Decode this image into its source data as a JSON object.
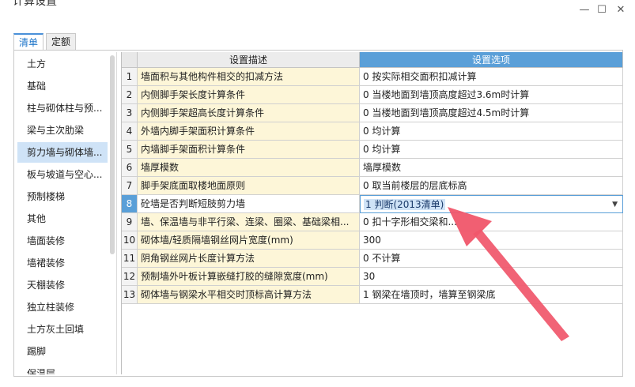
{
  "window": {
    "title": "计算设置"
  },
  "tabs": [
    {
      "label": "清单",
      "active": true
    },
    {
      "label": "定额",
      "active": false
    }
  ],
  "sidebar": {
    "items": [
      {
        "label": "土方"
      },
      {
        "label": "基础"
      },
      {
        "label": "柱与砌体柱与预..."
      },
      {
        "label": "梁与主次肋梁"
      },
      {
        "label": "剪力墙与砌体墙...",
        "selected": true
      },
      {
        "label": "板与坡道与空心..."
      },
      {
        "label": "预制楼梯"
      },
      {
        "label": "其他"
      },
      {
        "label": "墙面装修"
      },
      {
        "label": "墙裙装修"
      },
      {
        "label": "天棚装修"
      },
      {
        "label": "独立柱装修"
      },
      {
        "label": "土方灰土回填"
      },
      {
        "label": "踢脚"
      },
      {
        "label": "保温层"
      }
    ]
  },
  "grid": {
    "headers": {
      "description": "设置描述",
      "option": "设置选项"
    },
    "rows": [
      {
        "num": "1",
        "desc": "墙面积与其他构件相交的扣减方法",
        "opt": "0 按实际相交面积扣减计算"
      },
      {
        "num": "2",
        "desc": "内侧脚手架长度计算条件",
        "opt": "0 当楼地面到墙顶高度超过3.6m时计算"
      },
      {
        "num": "3",
        "desc": "内侧脚手架超高长度计算条件",
        "opt": "0 当楼地面到墙顶高度超过4.5m时计算"
      },
      {
        "num": "4",
        "desc": "外墙内脚手架面积计算条件",
        "opt": "0 均计算"
      },
      {
        "num": "5",
        "desc": "内墙脚手架面积计算条件",
        "opt": "0 均计算"
      },
      {
        "num": "6",
        "desc": "墙厚模数",
        "opt": "墙厚模数"
      },
      {
        "num": "7",
        "desc": "脚手架底面取楼地面原则",
        "opt": "0 取当前楼层的层底标高"
      },
      {
        "num": "8",
        "desc": "砼墙是否判断短肢剪力墙",
        "opt": "1 判断(2013清单)",
        "active": true
      },
      {
        "num": "9",
        "desc": "墙、保温墙与非平行梁、连梁、圈梁、基础梁相...",
        "opt": "0 扣十字形相交梁和..."
      },
      {
        "num": "10",
        "desc": "砌体墙/轻质隔墙钢丝网片宽度(mm)",
        "opt": "300"
      },
      {
        "num": "11",
        "desc": "阴角钢丝网片长度计算方法",
        "opt": "0 不计算"
      },
      {
        "num": "12",
        "desc": "预制墙外叶板计算嵌缝打胶的缝隙宽度(mm)",
        "opt": "30"
      },
      {
        "num": "13",
        "desc": "砌体墙与钢梁水平相交时顶标高计算方法",
        "opt": "1 钢梁在墙顶时，墙算至钢梁底"
      }
    ]
  },
  "colors": {
    "header_option_bg": "#5a9fd8",
    "description_cell_bg": "#fdf6d8",
    "sidebar_selected_bg": "#cfe3f7",
    "annotation_arrow": "#f0566a"
  },
  "icons": {
    "minimize": "minimize-icon",
    "maximize": "maximize-icon",
    "close": "close-icon",
    "dropdown": "chevron-down-icon"
  }
}
